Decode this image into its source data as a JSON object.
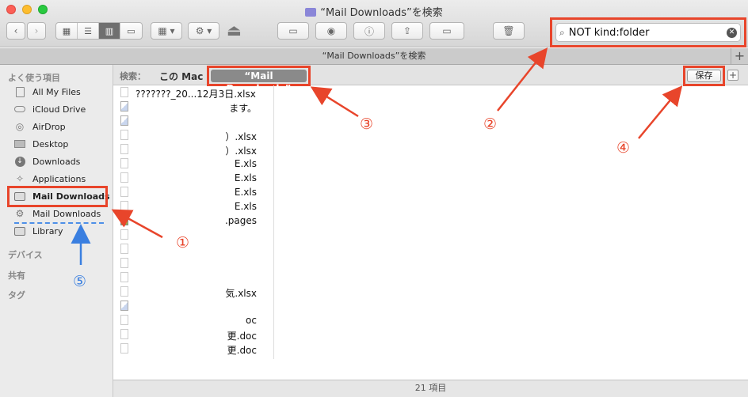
{
  "window": {
    "title": "“Mail Downloads”を検索",
    "tab_title": "“Mail Downloads”を検索",
    "folder_icon_color": "#8a86d8"
  },
  "toolbar": {
    "search_query": "NOT kind:folder",
    "view_buttons": [
      "icon-view",
      "list-view",
      "column-view",
      "coverflow-view"
    ],
    "active_view": "column-view",
    "accent_red": "#e8452b"
  },
  "sidebar": {
    "favorites_header": "よく使う項目",
    "items": [
      {
        "label": "All My Files",
        "icon": "all-files-icon"
      },
      {
        "label": "iCloud Drive",
        "icon": "icloud-icon"
      },
      {
        "label": "AirDrop",
        "icon": "airdrop-icon"
      },
      {
        "label": "Desktop",
        "icon": "desktop-icon"
      },
      {
        "label": "Downloads",
        "icon": "downloads-icon"
      },
      {
        "label": "Applications",
        "icon": "applications-icon"
      },
      {
        "label": "Mail Downloads",
        "icon": "folder-icon"
      },
      {
        "label": "Mail Downloads",
        "icon": "smart-folder-icon"
      },
      {
        "label": "Library",
        "icon": "folder-icon"
      }
    ],
    "devices_header": "デバイス",
    "shared_header": "共有",
    "tags_header": "タグ"
  },
  "scope_bar": {
    "label": "検索：",
    "this_mac": "この Mac",
    "folder_scope": "“Mail Downloads”",
    "save_label": "保存",
    "add_label": "+"
  },
  "files": [
    {
      "name": "???????_20...12月3日.xlsx",
      "icon": "blank"
    },
    {
      "name": "ます。",
      "icon": "pic"
    },
    {
      "name": "",
      "icon": "pic"
    },
    {
      "name": "）.xlsx",
      "icon": "blank"
    },
    {
      "name": "）.xlsx",
      "icon": "blank"
    },
    {
      "name": "E.xls",
      "icon": "blank"
    },
    {
      "name": "E.xls",
      "icon": "blank"
    },
    {
      "name": "E.xls",
      "icon": "blank"
    },
    {
      "name": "E.xls",
      "icon": "blank"
    },
    {
      "name": ".pages",
      "icon": "pages"
    },
    {
      "name": "",
      "icon": "blank"
    },
    {
      "name": "",
      "icon": "blank"
    },
    {
      "name": "",
      "icon": "blank"
    },
    {
      "name": "",
      "icon": "blank"
    },
    {
      "name": "気.xlsx",
      "icon": "blank"
    },
    {
      "name": "",
      "icon": "pic"
    },
    {
      "name": "oc",
      "icon": "blank"
    },
    {
      "name": "更.doc",
      "icon": "blank"
    },
    {
      "name": "更.doc",
      "icon": "blank"
    }
  ],
  "status": {
    "count": "21 項目"
  },
  "annotations": {
    "n1": "①",
    "n2": "②",
    "n3": "③",
    "n4": "④",
    "n5": "⑤"
  }
}
